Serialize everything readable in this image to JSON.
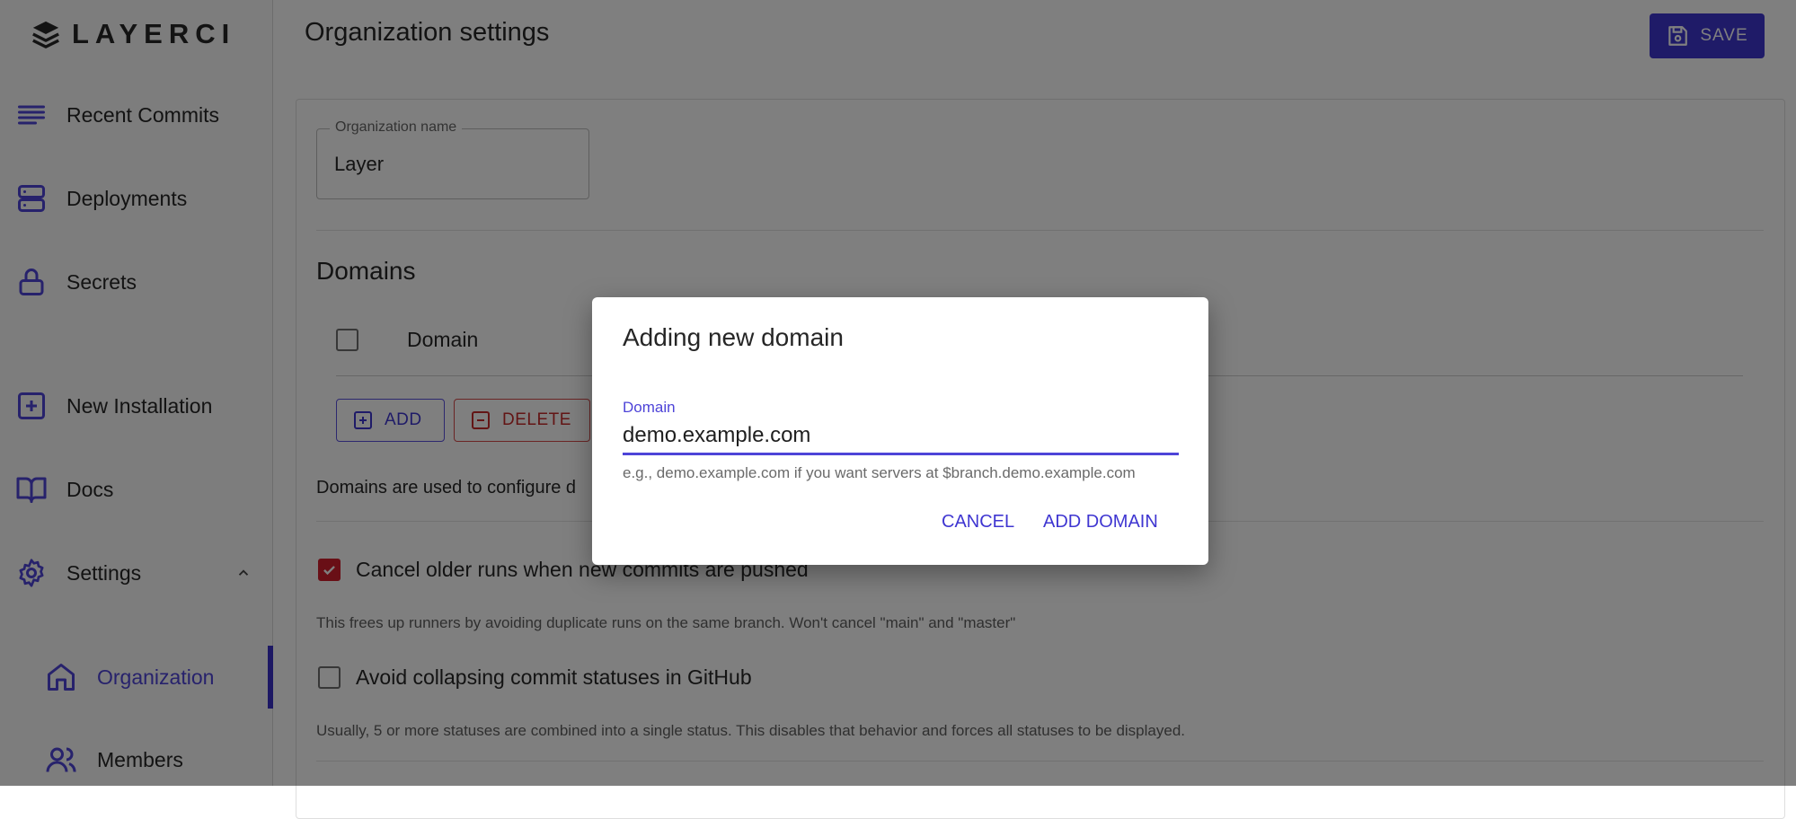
{
  "app": {
    "brand": "LAYERCI"
  },
  "sidebar": {
    "items": [
      {
        "label": "Recent Commits",
        "icon": "list-icon"
      },
      {
        "label": "Deployments",
        "icon": "server-icon"
      },
      {
        "label": "Secrets",
        "icon": "lock-icon"
      },
      {
        "label": "New Installation",
        "icon": "plus-square-icon"
      },
      {
        "label": "Docs",
        "icon": "book-icon"
      },
      {
        "label": "Settings",
        "icon": "gear-icon"
      }
    ],
    "sub_items": [
      {
        "label": "Organization",
        "icon": "home-icon"
      },
      {
        "label": "Members",
        "icon": "users-icon"
      }
    ]
  },
  "header": {
    "title": "Organization settings",
    "save_label": "SAVE"
  },
  "org": {
    "field_label": "Organization name",
    "value": "Layer"
  },
  "domains": {
    "title": "Domains",
    "column": "Domain",
    "add_label": "ADD",
    "delete_label": "DELETE",
    "description": "Domains are used to configure d"
  },
  "options": [
    {
      "label": "Cancel older runs when new commits are pushed",
      "checked": true,
      "help": "This frees up runners by avoiding duplicate runs on the same branch. Won't cancel \"main\" and \"master\""
    },
    {
      "label": "Avoid collapsing commit statuses in GitHub",
      "checked": false,
      "help": "Usually, 5 or more statuses are combined into a single status. This disables that behavior and forces all statuses to be displayed."
    }
  ],
  "dialog": {
    "title": "Adding new domain",
    "field_label": "Domain",
    "value": "demo.example.com",
    "helper": "e.g., demo.example.com if you want servers at $branch.demo.example.com",
    "cancel_label": "CANCEL",
    "confirm_label": "ADD DOMAIN"
  },
  "colors": {
    "accent": "#3f36d1",
    "danger": "#d21f2c"
  }
}
